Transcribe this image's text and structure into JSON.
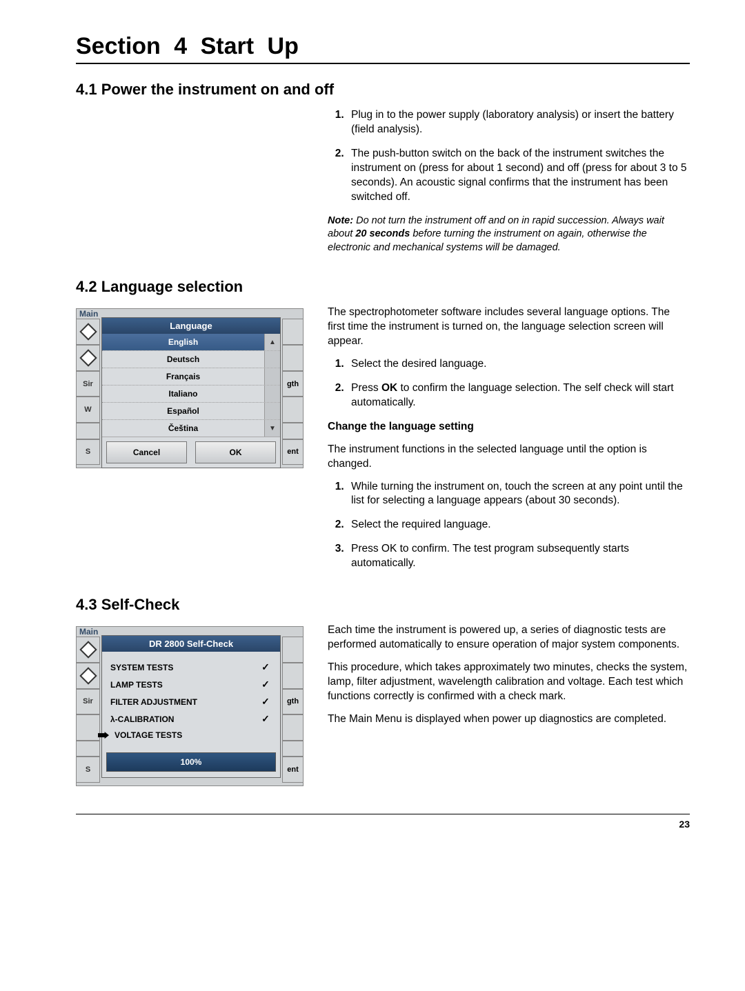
{
  "section": {
    "title": "Section 4     Start Up"
  },
  "s41": {
    "heading": "4.1  Power the instrument on and off",
    "steps": [
      "Plug in to the power supply (laboratory analysis) or insert the battery (field analysis).",
      "The push-button switch on the back of the instrument switches the instrument on (press for about 1 second) and off (press for about 3 to 5 seconds). An acoustic signal confirms that the instrument has been switched off."
    ],
    "note_label": "Note:",
    "note_pre": " Do not turn the instrument off and on in rapid succession. Always wait about ",
    "note_bold": "20 seconds",
    "note_post": " before turning the instrument on again, otherwise the electronic and mechanical systems will be damaged."
  },
  "s42": {
    "heading": "4.2  Language selection",
    "intro": "The spectrophotometer software includes several language options. The first time the instrument is turned on, the language selection screen will appear.",
    "stepsA": [
      "Select the desired language.",
      "Press OK to confirm the language selection. The self check will start automatically."
    ],
    "ok_word": "OK",
    "change_heading": "Change the language setting",
    "change_intro": "The instrument functions in the selected language until the option is changed.",
    "stepsB": [
      "While turning the instrument on, touch the screen at any point until the list for selecting a language appears (about 30 seconds).",
      "Select the required language.",
      "Press OK to confirm. The test program subsequently starts automatically."
    ],
    "dialog": {
      "bg_label": "Main",
      "title": "Language",
      "items": [
        "English",
        "Deutsch",
        "Français",
        "Italiano",
        "Español",
        "Čeština"
      ],
      "cancel": "Cancel",
      "ok": "OK",
      "side_labels": {
        "sir": "Sir",
        "w": "W",
        "s": "S"
      },
      "rt_labels": {
        "gth": "gth",
        "ent": "ent"
      }
    }
  },
  "s43": {
    "heading": "4.3  Self-Check",
    "p1": "Each time the instrument is powered up, a series of diagnostic tests are performed automatically to ensure operation of major system components.",
    "p2": "This procedure, which takes approximately two minutes, checks the system, lamp, filter adjustment, wavelength calibration and voltage. Each test which functions correctly is confirmed with a check mark.",
    "p3": "The Main Menu is displayed when power up diagnostics are completed.",
    "dialog": {
      "bg_label": "Main",
      "title": "DR 2800  Self-Check",
      "tests": [
        {
          "label": "SYSTEM TESTS",
          "done": true,
          "current": false
        },
        {
          "label": "LAMP TESTS",
          "done": true,
          "current": false
        },
        {
          "label": "FILTER ADJUSTMENT",
          "done": true,
          "current": false
        },
        {
          "label": "λ-CALIBRATION",
          "done": true,
          "current": false
        },
        {
          "label": "VOLTAGE TESTS",
          "done": false,
          "current": true
        }
      ],
      "progress": "100%",
      "side_labels": {
        "sir": "Sir",
        "s": "S"
      },
      "rt_labels": {
        "gth": "gth",
        "ent": "ent"
      }
    }
  },
  "page_number": "23"
}
